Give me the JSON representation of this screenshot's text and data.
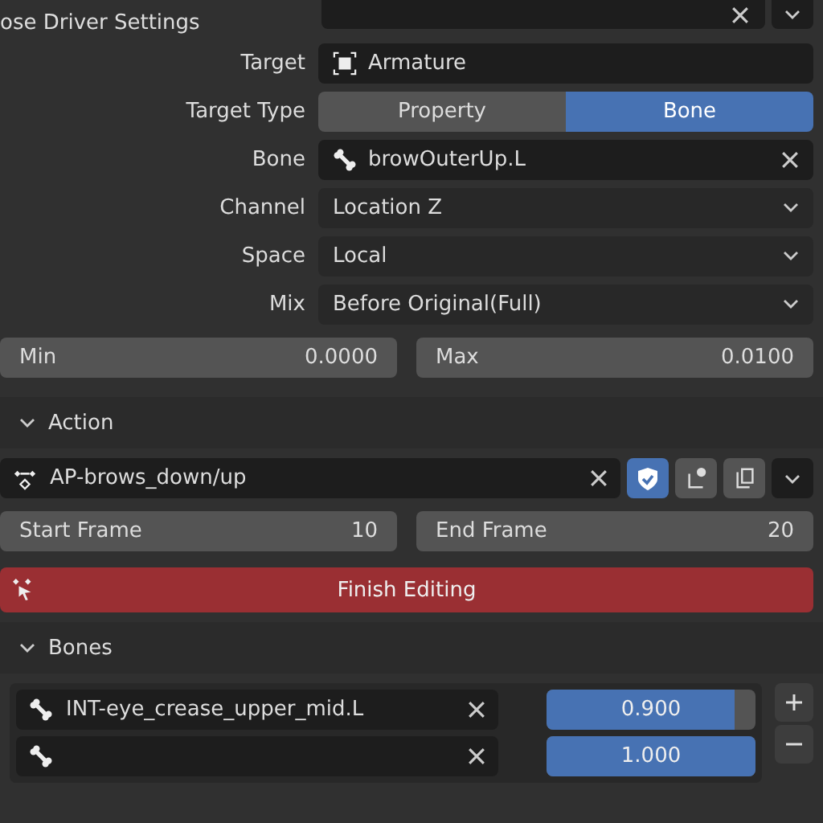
{
  "panel_title": "ose Driver Settings",
  "fields": [
    {
      "kind": "object",
      "label": "Target",
      "value": "Armature"
    },
    {
      "kind": "toggle",
      "label": "Target Type",
      "options": [
        {
          "label": "Property",
          "selected": false
        },
        {
          "label": "Bone",
          "selected": true
        }
      ]
    },
    {
      "kind": "bone",
      "label": "Bone",
      "value": "browOuterUp.L"
    },
    {
      "kind": "menu",
      "label": "Channel",
      "value": "Location Z"
    },
    {
      "kind": "menu",
      "label": "Space",
      "value": "Local"
    },
    {
      "kind": "menu",
      "label": "Mix",
      "value": "Before Original(Full)"
    }
  ],
  "range": [
    {
      "label": "Min",
      "value": "0.0000"
    },
    {
      "label": "Max",
      "value": "0.0100"
    }
  ],
  "action": {
    "header": "Action",
    "expanded": true,
    "name": "AP-brows_down/up",
    "fake_user": true,
    "frames": [
      {
        "label": "Start Frame",
        "value": "10"
      },
      {
        "label": "End Frame",
        "value": "20"
      }
    ],
    "finish_button": "Finish Editing"
  },
  "bones": {
    "header": "Bones",
    "expanded": true,
    "items": [
      {
        "name": "INT-eye_crease_upper_mid.L",
        "weight": "0.900",
        "level": 0.9
      },
      {
        "weight": "1.000",
        "level": 1.0
      }
    ]
  }
}
